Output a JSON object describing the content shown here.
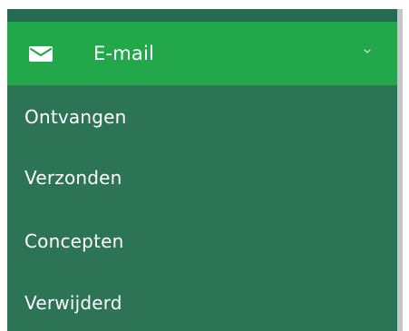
{
  "menu": {
    "title": "E-mail",
    "icon": "mail-icon",
    "toggle_icon": "chevron-down-icon",
    "items": [
      {
        "label": "Ontvangen"
      },
      {
        "label": "Verzonden"
      },
      {
        "label": "Concepten"
      },
      {
        "label": "Verwijderd"
      }
    ]
  },
  "colors": {
    "sidebar_background": "#2d7457",
    "active_header": "#22a84b",
    "text": "#ffffff"
  }
}
